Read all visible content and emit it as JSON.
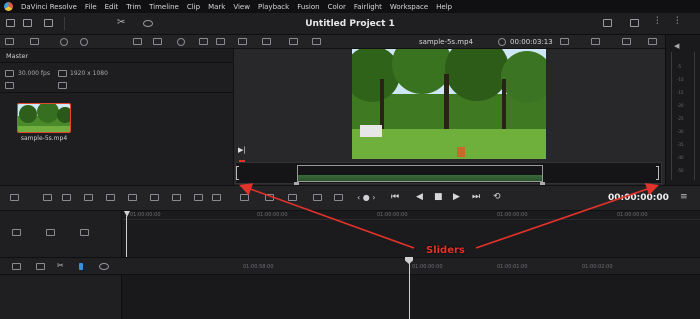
{
  "menubar": {
    "app_name": "DaVinci Resolve",
    "items": [
      "File",
      "Edit",
      "Trim",
      "Timeline",
      "Clip",
      "Mark",
      "View",
      "Playback",
      "Fusion",
      "Color",
      "Fairlight",
      "Workspace",
      "Help"
    ]
  },
  "title": "Untitled Project 1",
  "media_pool": {
    "header": "Master",
    "fps": "30.000 fps",
    "resolution": "1920 x 1080",
    "clip_name": "sample-5s.mp4"
  },
  "viewer": {
    "file_name": "sample-5s.mp4",
    "timecode": "00:00:03:13"
  },
  "transport": {
    "timecode": "00:00:00:00"
  },
  "timeline": {
    "upper_ruler": [
      "01:00:00:00",
      "01:00:00:00",
      "01:00:00:00",
      "01:00:00:00",
      "01:00:00:00"
    ],
    "lower_ruler": [
      "01:00:58:00",
      "01:00:00:00",
      "01:00:01:00",
      "01:00:02:00"
    ]
  },
  "meters": {
    "scale": [
      "-5",
      "-10",
      "-15",
      "-20",
      "-25",
      "-30",
      "-35",
      "-40",
      "-50"
    ]
  },
  "annotation": {
    "label": "Sliders"
  },
  "colors": {
    "annotation_red": "#e3322a",
    "thumb_border": "#e04a2c",
    "background": "#1b1b1d"
  }
}
